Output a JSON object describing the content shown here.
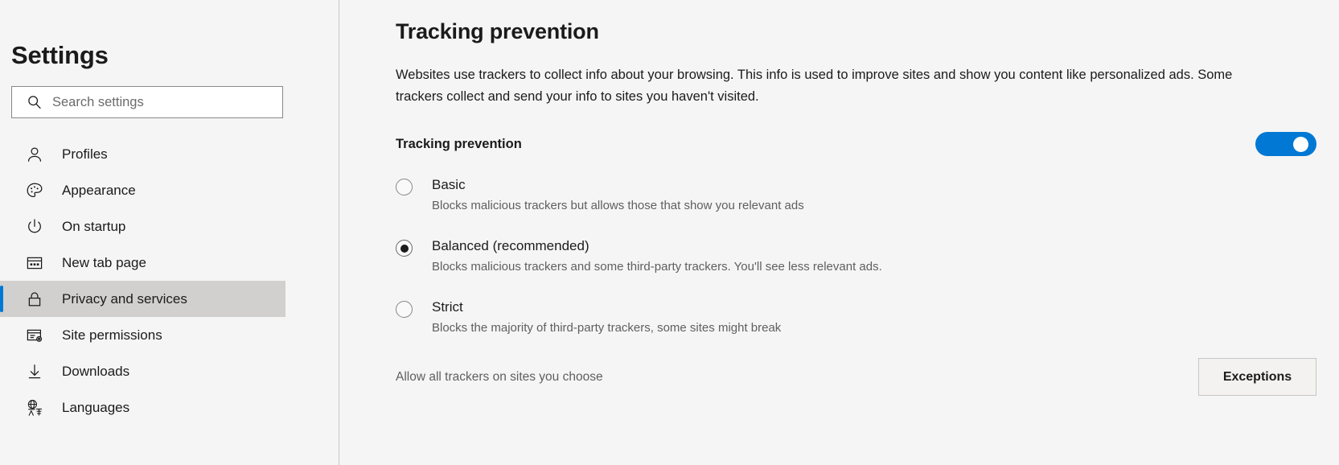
{
  "sidebar": {
    "title": "Settings",
    "search": {
      "placeholder": "Search settings",
      "value": "",
      "icon": "search-icon"
    },
    "items": [
      {
        "label": "Profiles",
        "icon": "person-icon",
        "selected": false
      },
      {
        "label": "Appearance",
        "icon": "palette-icon",
        "selected": false
      },
      {
        "label": "On startup",
        "icon": "power-icon",
        "selected": false
      },
      {
        "label": "New tab page",
        "icon": "new-tab-page-icon",
        "selected": false
      },
      {
        "label": "Privacy and services",
        "icon": "lock-icon",
        "selected": true
      },
      {
        "label": "Site permissions",
        "icon": "site-settings-icon",
        "selected": false
      },
      {
        "label": "Downloads",
        "icon": "download-icon",
        "selected": false
      },
      {
        "label": "Languages",
        "icon": "language-icon",
        "selected": false
      }
    ]
  },
  "main": {
    "page_title": "Tracking prevention",
    "page_description": "Websites use trackers to collect info about your browsing. This info is used to improve sites and show you content like personalized ads. Some trackers collect and send your info to sites you haven't visited.",
    "section": {
      "heading": "Tracking prevention",
      "toggle_state": "on"
    },
    "options": [
      {
        "label": "Basic",
        "description": "Blocks malicious trackers but allows those that show you relevant ads",
        "selected": false
      },
      {
        "label": "Balanced (recommended)",
        "description": "Blocks malicious trackers and some third-party trackers. You'll see less relevant ads.",
        "selected": true
      },
      {
        "label": "Strict",
        "description": "Blocks the majority of third-party trackers, some sites might break",
        "selected": false
      }
    ],
    "footer": {
      "label": "Allow all trackers on sites you choose",
      "button_label": "Exceptions"
    }
  },
  "colors": {
    "accent": "#0078d4",
    "page_background": "#f5f5f5",
    "selected_item_background": "#d2d0ce",
    "text_primary": "#1b1b1b",
    "text_secondary": "#5f5f5f"
  }
}
